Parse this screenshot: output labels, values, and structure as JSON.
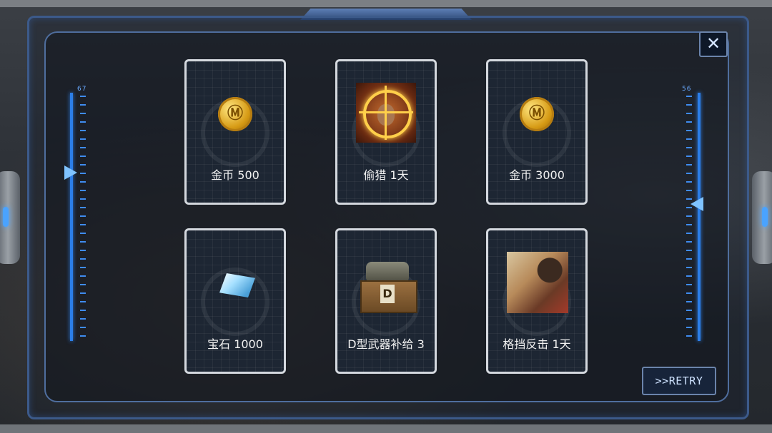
{
  "gauges": {
    "left_label": "67",
    "right_label": "56"
  },
  "close": {
    "label": "✕"
  },
  "rewards": [
    {
      "label": "金币 500",
      "icon": "gold-coin-icon"
    },
    {
      "label": "偷猎 1天",
      "icon": "poaching-deer-crosshair-icon"
    },
    {
      "label": "金币 3000",
      "icon": "gold-coin-icon"
    },
    {
      "label": "宝石 1000",
      "icon": "gem-crystal-icon"
    },
    {
      "label": "D型武器补给 3",
      "icon": "weapon-supply-crate-icon"
    },
    {
      "label": "格挡反击 1天",
      "icon": "block-counter-fighter-icon"
    }
  ],
  "retry": {
    "label": ">>RETRY"
  },
  "colors": {
    "frame_blue": "#3c5a8a",
    "gauge_blue": "#2c7ee8",
    "card_border": "#d4d8de",
    "gold": "#d69a14"
  }
}
